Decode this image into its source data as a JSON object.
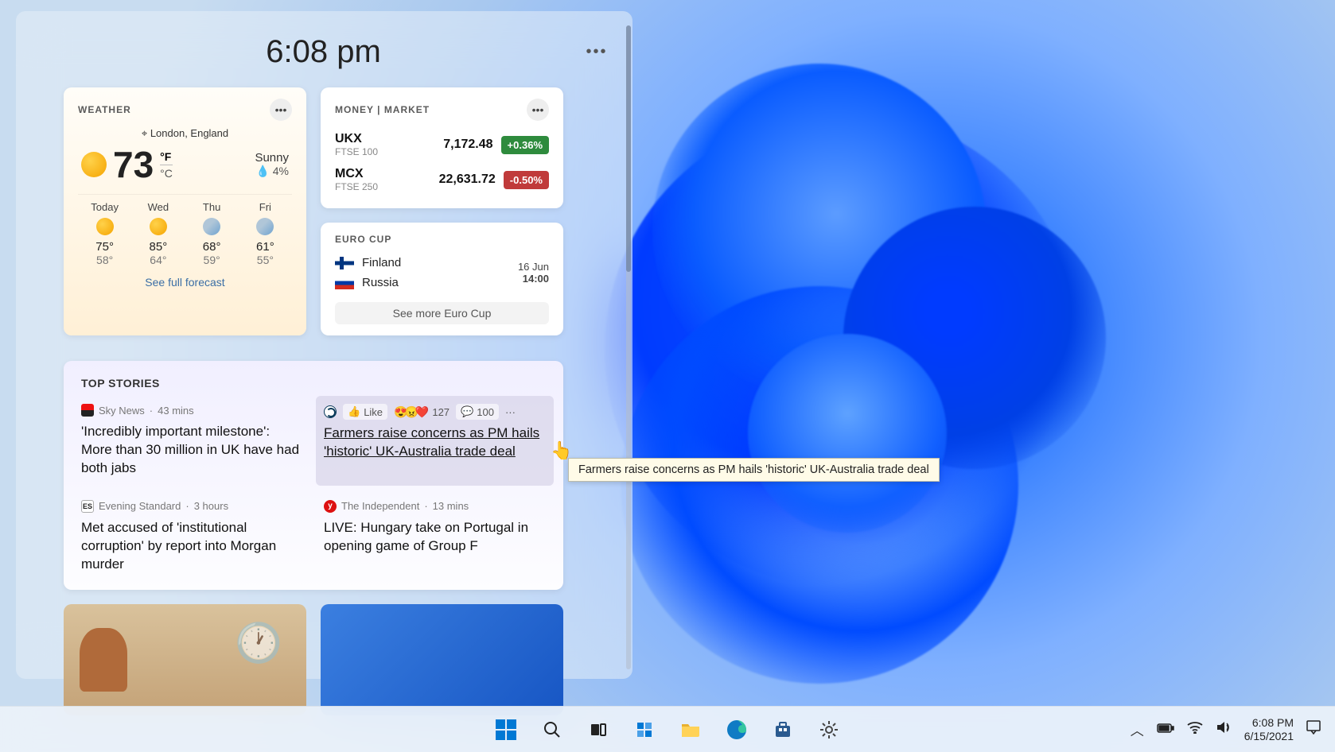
{
  "panel": {
    "time": "6:08 pm"
  },
  "weather": {
    "title": "WEATHER",
    "location": "London, England",
    "temp": "73",
    "unit_f": "°F",
    "unit_c": "°C",
    "cond": "Sunny",
    "precip": "💧 4%",
    "see_full": "See full forecast",
    "forecast": [
      {
        "day": "Today",
        "icon": "sun",
        "hi": "75°",
        "lo": "58°"
      },
      {
        "day": "Wed",
        "icon": "sun",
        "hi": "85°",
        "lo": "64°"
      },
      {
        "day": "Thu",
        "icon": "rain",
        "hi": "68°",
        "lo": "59°"
      },
      {
        "day": "Fri",
        "icon": "rain",
        "hi": "61°",
        "lo": "55°"
      }
    ]
  },
  "money": {
    "title": "MONEY | MARKET",
    "rows": [
      {
        "sym": "UKX",
        "sub": "FTSE 100",
        "val": "7,172.48",
        "chg": "+0.36%",
        "dir": "up"
      },
      {
        "sym": "MCX",
        "sub": "FTSE 250",
        "val": "22,631.72",
        "chg": "-0.50%",
        "dir": "down"
      }
    ]
  },
  "euro": {
    "title": "EURO CUP",
    "team_a": "Finland",
    "team_b": "Russia",
    "date": "16 Jun",
    "time": "14:00",
    "see_more": "See more Euro Cup"
  },
  "stories": {
    "title": "TOP STORIES",
    "items": [
      {
        "source": "Sky News",
        "age": "43 mins",
        "headline": "'Incredibly important milestone': More than 30 million in UK have had both jabs"
      },
      {
        "source": "The Guardian",
        "age": "",
        "like_label": "Like",
        "reactions": "127",
        "comments": "100",
        "headline": "Farmers raise concerns as PM hails 'historic' UK-Australia trade deal"
      },
      {
        "source": "Evening Standard",
        "age": "3 hours",
        "headline": "Met accused of 'institutional corruption' by report into Morgan murder"
      },
      {
        "source": "The Independent",
        "age": "13 mins",
        "headline": "LIVE: Hungary take on Portugal in opening game of Group F"
      }
    ]
  },
  "tooltip": "Farmers raise concerns as PM hails 'historic' UK-Australia trade deal",
  "taskbar": {
    "time": "6:08 PM",
    "date": "6/15/2021"
  }
}
